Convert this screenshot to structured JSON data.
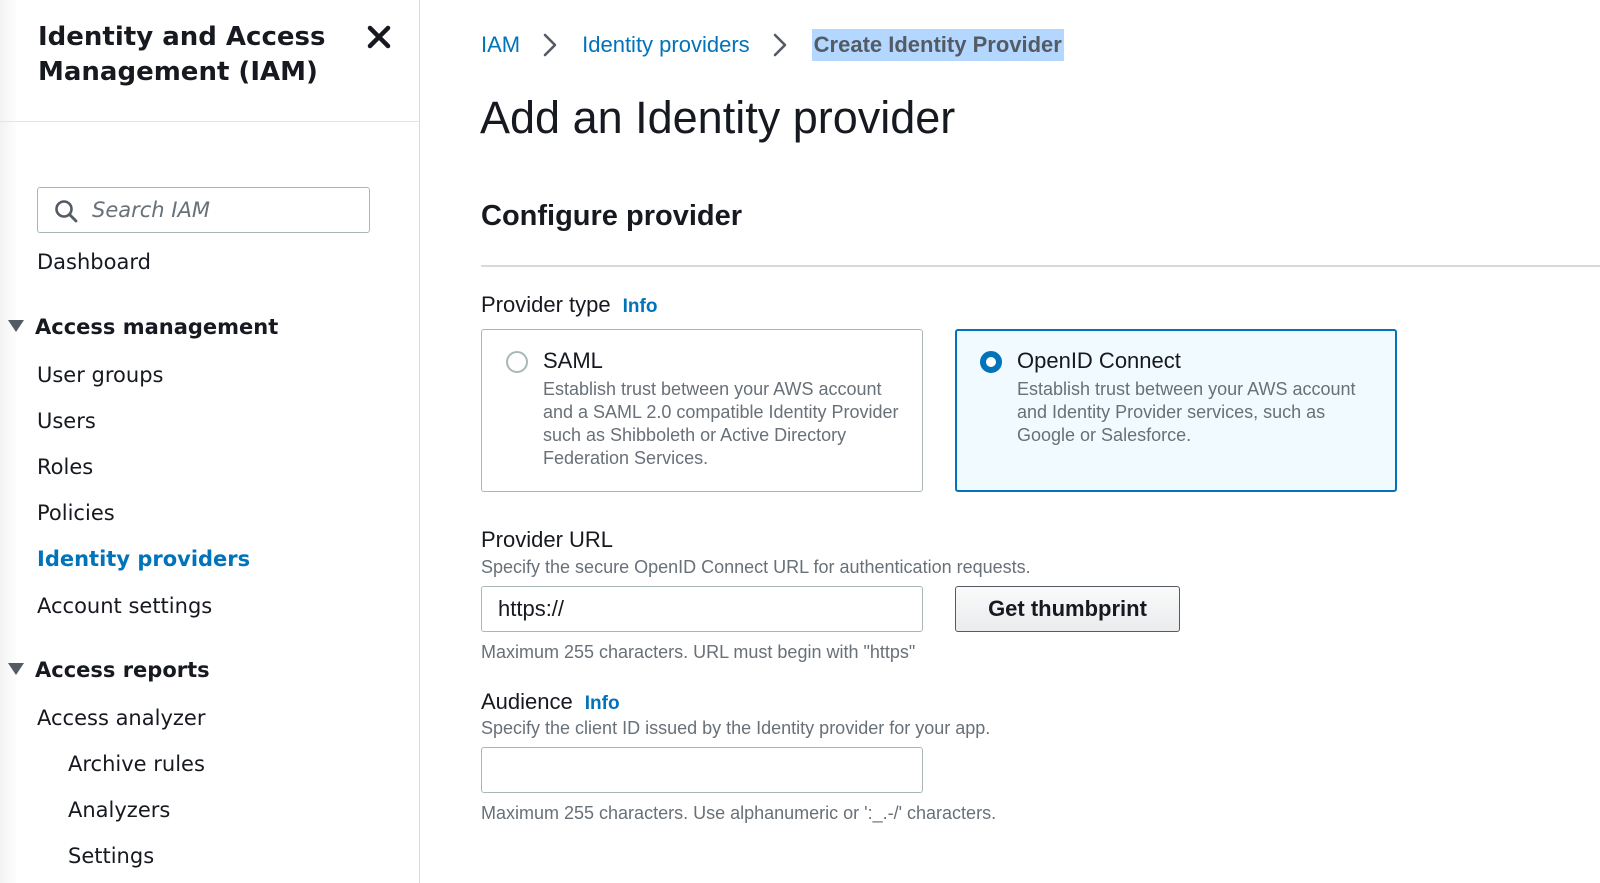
{
  "sidebar": {
    "title": "Identity and Access Management (IAM)",
    "search": {
      "placeholder": "Search IAM",
      "value": ""
    },
    "dashboard": "Dashboard",
    "access_management": {
      "label": "Access management",
      "items": [
        "User groups",
        "Users",
        "Roles",
        "Policies",
        "Identity providers",
        "Account settings"
      ],
      "active": "Identity providers"
    },
    "access_reports": {
      "label": "Access reports",
      "items": [
        "Access analyzer"
      ],
      "sub_items": [
        "Archive rules",
        "Analyzers",
        "Settings"
      ]
    }
  },
  "breadcrumb": {
    "items": [
      "IAM",
      "Identity providers"
    ],
    "current": "Create Identity Provider"
  },
  "page_title": "Add an Identity provider",
  "section_title": "Configure provider",
  "provider_type": {
    "label": "Provider type",
    "info": "Info",
    "options": [
      {
        "title": "SAML",
        "description": "Establish trust between your AWS account and a SAML 2.0 compatible Identity Provider such as Shibboleth or Active Directory Federation Services.",
        "selected": false
      },
      {
        "title": "OpenID Connect",
        "description": "Establish trust between your AWS account and Identity Provider services, such as Google or Salesforce.",
        "selected": true
      }
    ]
  },
  "provider_url": {
    "label": "Provider URL",
    "description": "Specify the secure OpenID Connect URL for authentication requests.",
    "value": "https://",
    "hint": "Maximum 255 characters. URL must begin with \"https\"",
    "button": "Get thumbprint"
  },
  "audience": {
    "label": "Audience",
    "info": "Info",
    "description": "Specify the client ID issued by the Identity provider for your app.",
    "value": "",
    "hint": "Maximum 255 characters. Use alphanumeric or ':_.-/' characters."
  },
  "colors": {
    "link": "#0073bb",
    "selected_tile_bg": "#f1faff",
    "text_secondary": "#687078",
    "breadcrumb_highlight": "#b3d7ff"
  },
  "icons": {
    "close": "close-icon",
    "search": "search-icon",
    "breadcrumb_separator": "chevron-right-icon",
    "section_toggle": "caret-down-icon"
  }
}
